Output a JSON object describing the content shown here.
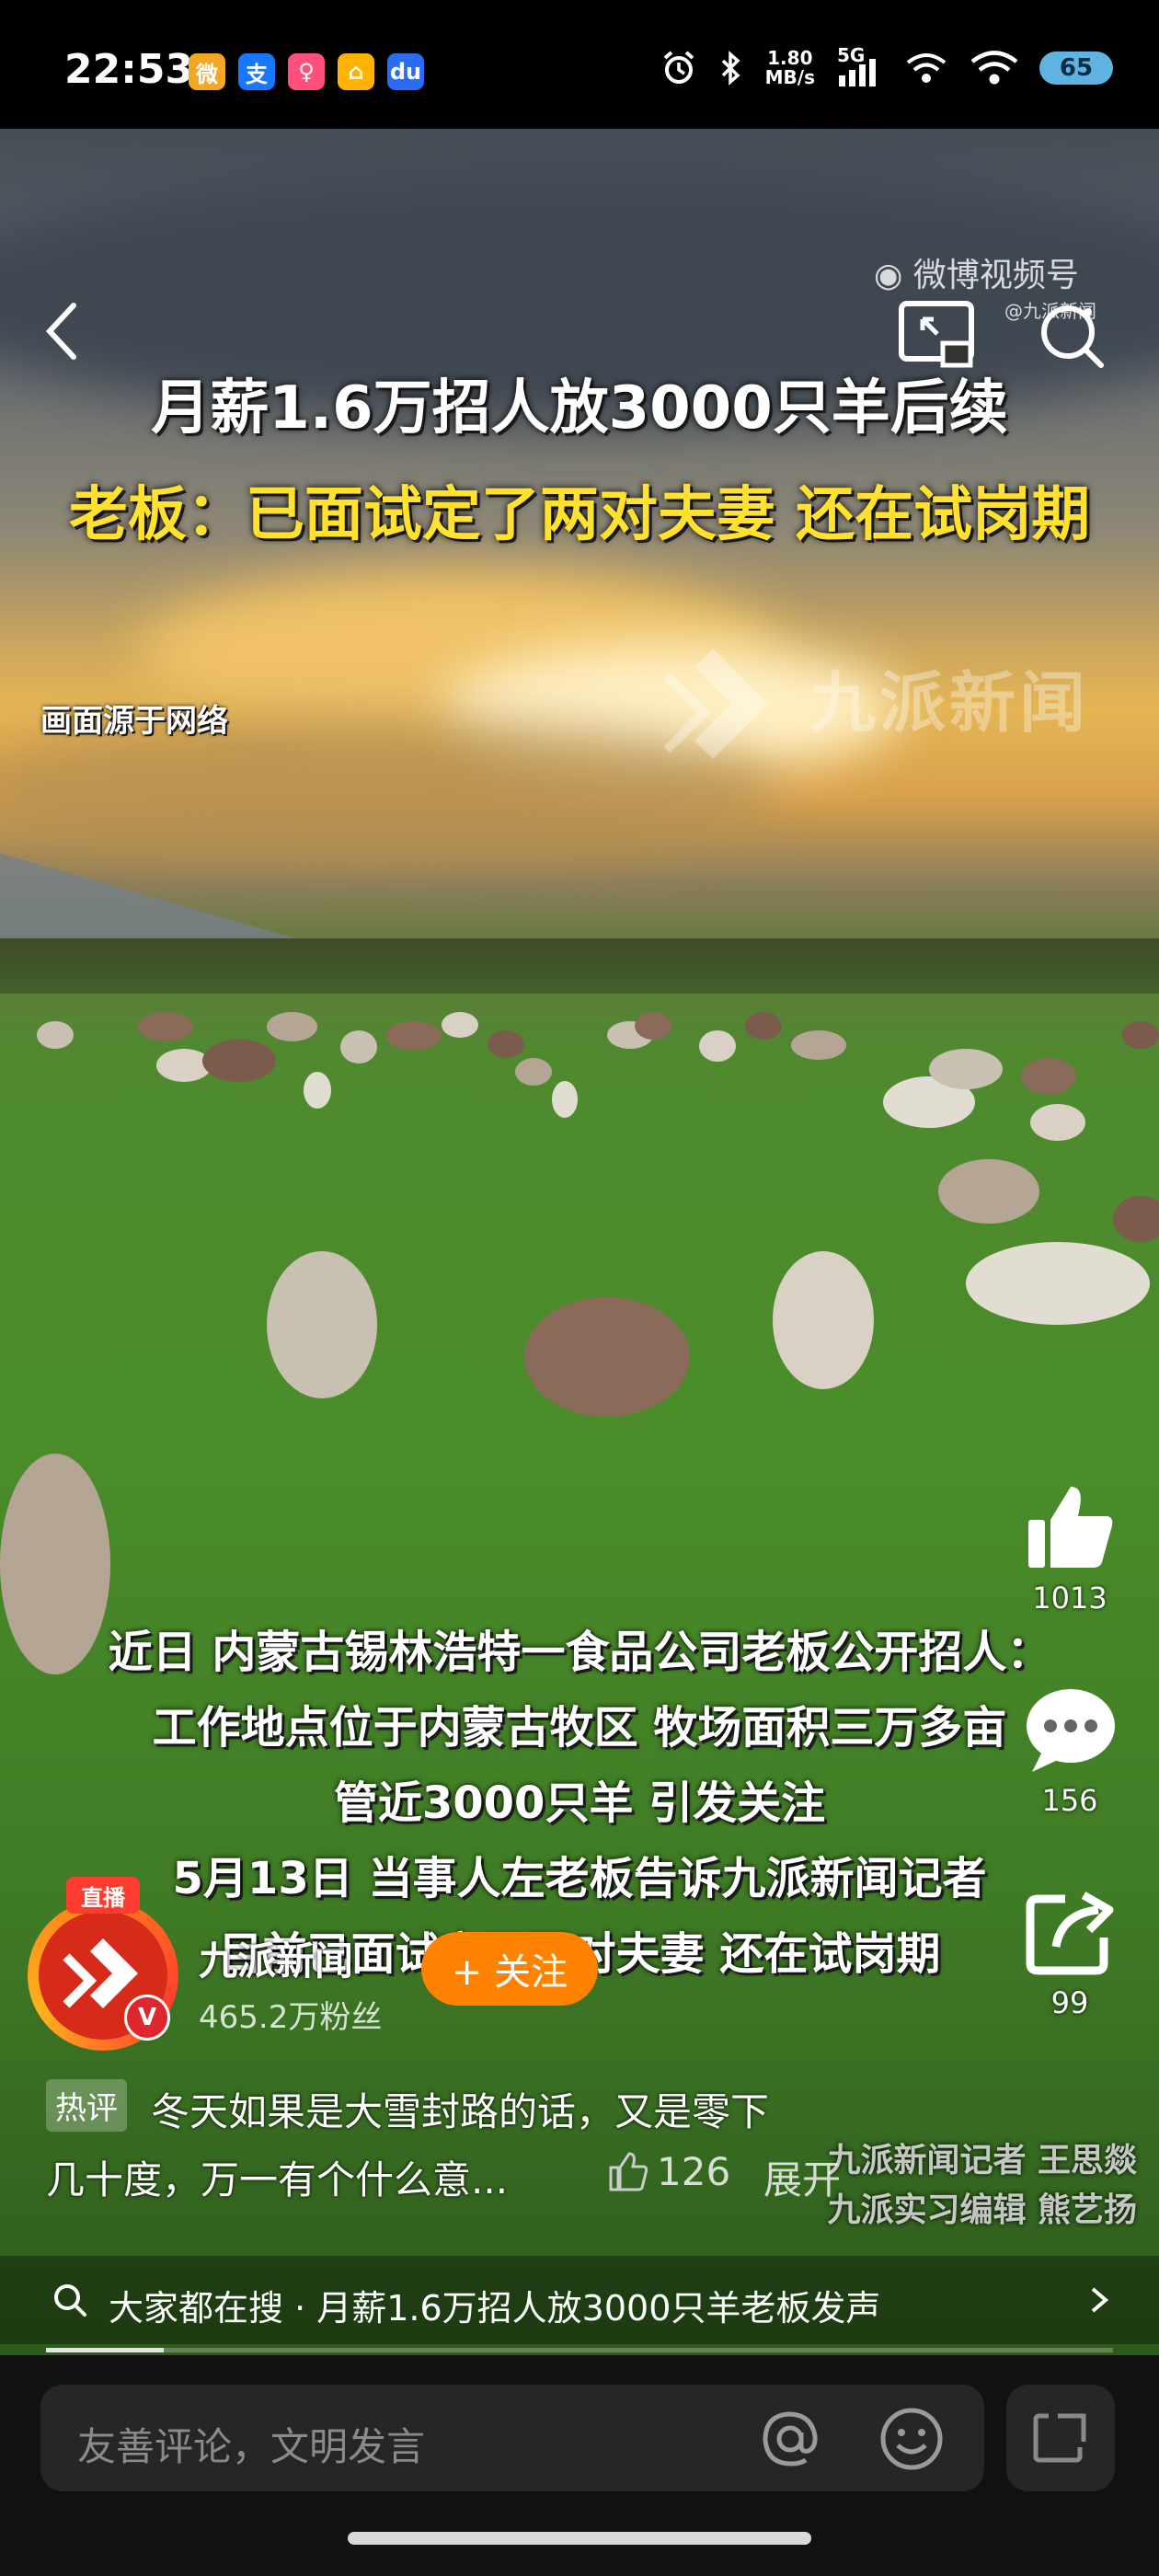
{
  "status_bar": {
    "time": "22:53",
    "net_speed_value": "1.80",
    "net_speed_unit": "MB/s",
    "signal_label": "5G",
    "battery": "65",
    "app_icons": [
      {
        "name": "weibo-app-icon",
        "glyph": "微",
        "color": "#f5a623"
      },
      {
        "name": "alipay-app-icon",
        "glyph": "支",
        "color": "#1677ff"
      },
      {
        "name": "bottle-app-icon",
        "glyph": "♀",
        "color": "#ff4f7b"
      },
      {
        "name": "car-app-icon",
        "glyph": "⌂",
        "color": "#ffb300"
      },
      {
        "name": "baidu-app-icon",
        "glyph": "du",
        "color": "#2b6cf5"
      }
    ]
  },
  "video": {
    "watermark_brand": "微博视频号",
    "watermark_handle": "@九派新闻",
    "headline_line1": "月薪1.6万招人放3000只羊后续",
    "headline_line2": "老板：已面试定了两对夫妻 还在试岗期",
    "source_note": "画面源于网络",
    "channel_watermark": "九派新闻",
    "subtitle_lines": [
      "近日 内蒙古锡林浩特一食品公司老板公开招人：",
      "工作地点位于内蒙古牧区 牧场面积三万多亩",
      "管近3000只羊 引发关注",
      "5月13日 当事人左老板告诉九派新闻记者",
      "目前已面试定了两对夫妻 还在试岗期"
    ],
    "credits": [
      "九派新闻记者 王思燚",
      "九派实习编辑 熊艺扬"
    ]
  },
  "actions": {
    "like_count": "1013",
    "comment_count": "156",
    "share_count": "99"
  },
  "author": {
    "live_label": "直播",
    "name": "九派新闻",
    "followers": "465.2万粉丝",
    "follow_label": "+ 关注",
    "verified_label": "V"
  },
  "hot_comment": {
    "tag": "热评",
    "text_line1": "冬天如果是大雪封路的话，又是零下",
    "text_line2": "几十度，万一有个什么意...",
    "likes": "126",
    "expand_label": "展开"
  },
  "search_hint": {
    "text": "大家都在搜 · 月薪1.6万招人放3000只羊老板发声"
  },
  "progress": 0.11,
  "bottom_bar": {
    "comment_placeholder": "友善评论，文明发言"
  }
}
